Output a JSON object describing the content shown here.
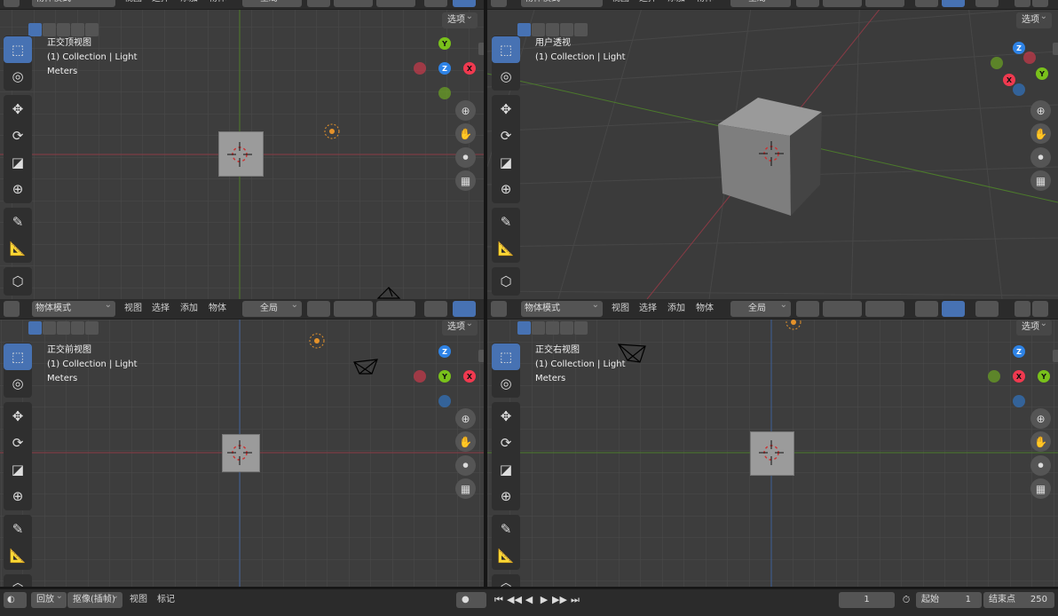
{
  "header": {
    "mode_label": "物体模式",
    "menu": [
      "视图",
      "选择",
      "添加",
      "物体"
    ],
    "transform_orientation": "全局"
  },
  "options_label": "选项",
  "viewports": {
    "top_left": {
      "view_name": "正交顶视图",
      "collection": "(1) Collection | Light",
      "units": "Meters"
    },
    "top_right": {
      "view_name": "用户透视",
      "collection": "(1) Collection | Light"
    },
    "bottom_left": {
      "view_name": "正交前视图",
      "collection": "(1) Collection | Light",
      "units": "Meters"
    },
    "bottom_right": {
      "view_name": "正交右视图",
      "collection": "(1) Collection | Light",
      "units": "Meters"
    }
  },
  "gizmos": {
    "top": [
      "Y",
      "Z",
      "X"
    ],
    "front": [
      "Z",
      "Y",
      "X"
    ],
    "right": [
      "Z",
      "X",
      "Y"
    ],
    "user": [
      "Z",
      "Y",
      "X"
    ]
  },
  "axis_colors": {
    "x": "#f0394f",
    "y": "#79c11b",
    "z": "#2e83e6"
  },
  "tool_icons": [
    "select-box-icon",
    "cursor-icon",
    "move-icon",
    "rotate-icon",
    "scale-icon",
    "transform-icon",
    "annotate-icon",
    "measure-icon",
    "add-cube-icon"
  ],
  "nav_icons": [
    "zoom-icon",
    "pan-hand-icon",
    "camera-icon",
    "grid-icon"
  ],
  "timeline": {
    "playback_label": "回放",
    "keying_label": "抠像(插帧)",
    "view_label": "视图",
    "marker_label": "标记",
    "current_frame": "1",
    "start_label": "起始",
    "start_frame": "1",
    "end_label": "结束点",
    "end_frame": "250"
  }
}
